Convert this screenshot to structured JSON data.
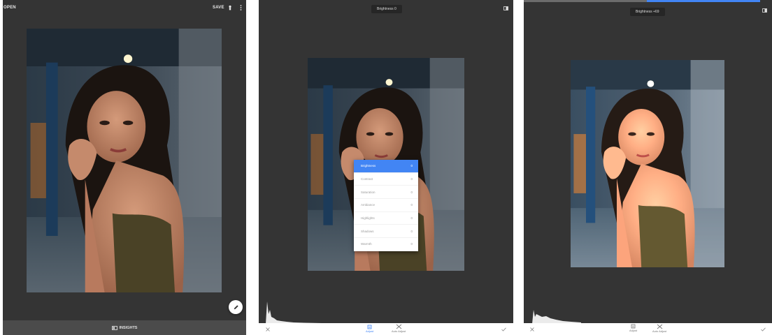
{
  "screen1": {
    "open_label": "OPEN",
    "save_label": "SAVE",
    "insights_label": "INSIGHTS",
    "icons": {
      "info": "tune-info-icon",
      "more": "more-vert-icon",
      "edit": "pencil-icon",
      "insights": "insights-icon"
    }
  },
  "screen2": {
    "adjust_title": "Brightness 0",
    "menu_items": [
      {
        "label": "Brightness",
        "value": "0",
        "active": true
      },
      {
        "label": "Contrast",
        "value": "0",
        "active": false
      },
      {
        "label": "Saturation",
        "value": "0",
        "active": false
      },
      {
        "label": "Ambiance",
        "value": "0",
        "active": false
      },
      {
        "label": "Highlights",
        "value": "0",
        "active": false
      },
      {
        "label": "Shadows",
        "value": "0",
        "active": false
      },
      {
        "label": "Warmth",
        "value": "0",
        "active": false
      }
    ],
    "tools": [
      {
        "label": "Adjust",
        "icon": "tune-icon",
        "active": true
      },
      {
        "label": "Auto Adjust",
        "icon": "magic-wand-icon",
        "active": false
      }
    ]
  },
  "screen3": {
    "adjust_title": "Brightness +69",
    "tools": [
      {
        "label": "Adjust",
        "icon": "tune-icon",
        "active": false
      },
      {
        "label": "Auto Adjust",
        "icon": "magic-wand-icon",
        "active": false
      }
    ]
  },
  "colors": {
    "accent": "#4285f4",
    "panel_bg": "#343434",
    "photo_bg": "#2d3c4c"
  }
}
